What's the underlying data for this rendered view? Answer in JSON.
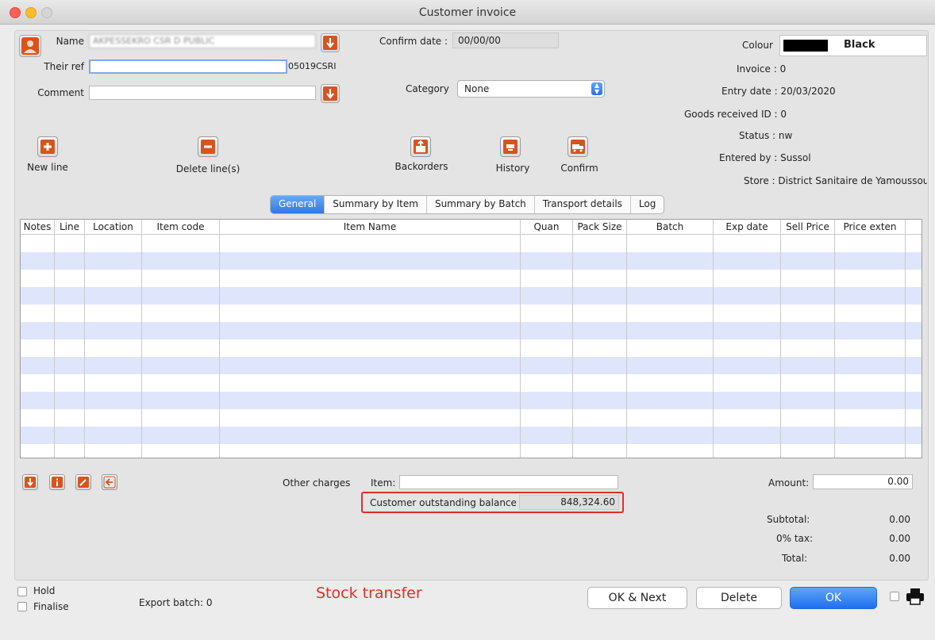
{
  "window": {
    "title": "Customer invoice"
  },
  "header": {
    "name_label": "Name",
    "name_value": "AKPESSEKRO CSR D PUBLIC",
    "their_ref_label": "Their ref",
    "their_ref_suffix": "05019CSRI",
    "comment_label": "Comment",
    "confirm_date_label": "Confirm date :",
    "confirm_date_value": "00/00/00",
    "category_label": "Category",
    "category_value": "None",
    "colour_label": "Colour",
    "colour_value": "Black",
    "colour_swatch": "#000000",
    "invoice": "Invoice : 0",
    "entry_date": "Entry date : 20/03/2020",
    "goods_received": "Goods received ID : 0",
    "status": "Status : nw",
    "entered_by": "Entered by : Sussol",
    "store": "Store : District Sanitaire de Yamoussoukro"
  },
  "toolbar": {
    "new_line": "New line",
    "delete_lines": "Delete line(s)",
    "backorders": "Backorders",
    "history": "History",
    "confirm": "Confirm"
  },
  "tabs": [
    "General",
    "Summary by Item",
    "Summary by Batch",
    "Transport details",
    "Log"
  ],
  "table": {
    "columns": [
      "Notes",
      "Line",
      "Location",
      "Item code",
      "Item Name",
      "Quan",
      "Pack Size",
      "Batch",
      "Exp date",
      "Sell Price",
      "Price exten"
    ],
    "rows": []
  },
  "footer": {
    "other_charges": "Other charges",
    "item_label": "Item:",
    "outstanding_label": "Customer outstanding balance",
    "outstanding_value": "848,324.60",
    "amount_label": "Amount:",
    "amount_value": "0.00",
    "subtotal_label": "Subtotal:",
    "subtotal_value": "0.00",
    "tax_label": "0% tax:",
    "tax_value": "0.00",
    "total_label": "Total:",
    "total_value": "0.00",
    "hold": "Hold",
    "finalise": "Finalise",
    "export_batch": "Export batch: 0",
    "annotation": "Stock transfer",
    "ok_next": "OK & Next",
    "delete": "Delete",
    "ok": "OK"
  },
  "colors": {
    "accent": "#3178e0",
    "highlight_box": "#e0302a",
    "annotation": "#e0302a",
    "icon_orange": "#d9531e"
  }
}
